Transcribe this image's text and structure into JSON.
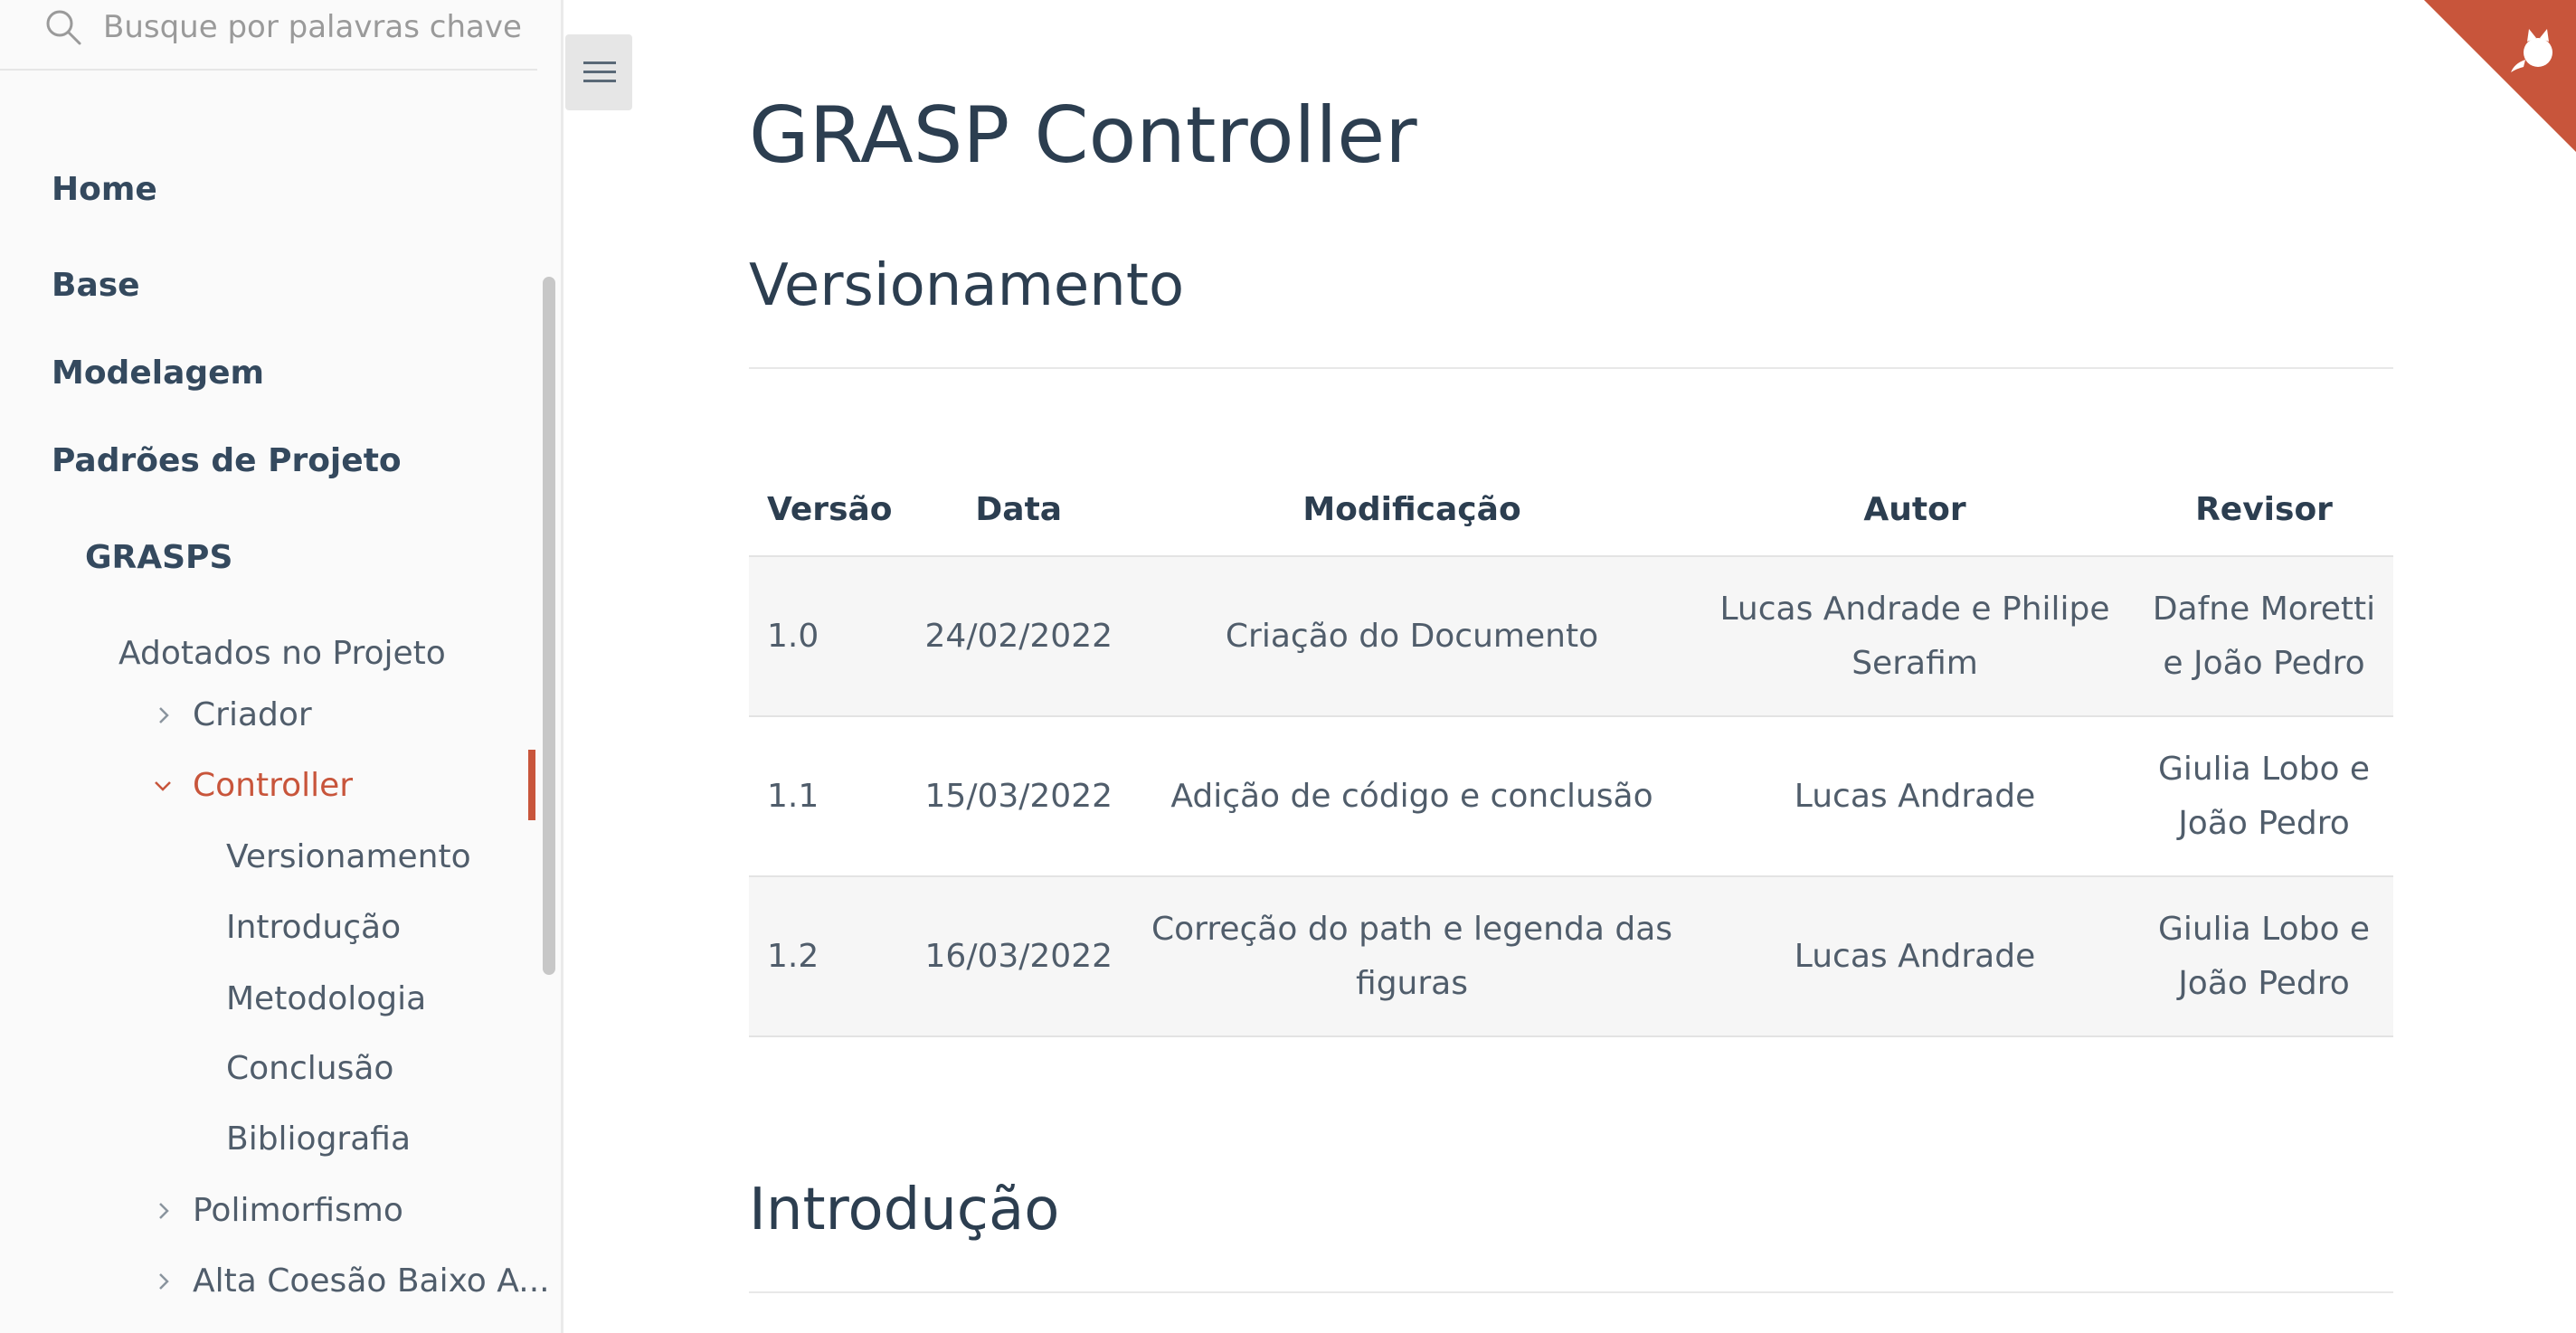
{
  "search": {
    "placeholder": "Busque por palavras chave",
    "icon": "search-icon"
  },
  "sidebar": {
    "items": [
      {
        "label": "Home"
      },
      {
        "label": "Base"
      },
      {
        "label": "Modelagem"
      },
      {
        "label": "Padrões de Projeto"
      },
      {
        "label": "GRASPS"
      },
      {
        "label": "Adotados no Projeto"
      },
      {
        "label": "Criador"
      },
      {
        "label": "Controller"
      },
      {
        "label": "Versionamento"
      },
      {
        "label": "Introdução"
      },
      {
        "label": "Metodologia"
      },
      {
        "label": "Conclusão"
      },
      {
        "label": "Bibliografia"
      },
      {
        "label": "Polimorfismo"
      },
      {
        "label": "Alta Coesão Baixo A..."
      }
    ],
    "active_color": "#c8553b"
  },
  "toolbar": {
    "menu_icon": "hamburger-menu-icon"
  },
  "corner": {
    "icon": "github-octocat-icon",
    "color": "#c8553b"
  },
  "main": {
    "title": "GRASP Controller",
    "section1": "Versionamento",
    "section2": "Introdução",
    "table": {
      "headers": [
        "Versão",
        "Data",
        "Modificação",
        "Autor",
        "Revisor"
      ],
      "rows": [
        [
          "1.0",
          "24/02/2022",
          "Criação do Documento",
          "Lucas Andrade e Philipe Serafim",
          "Dafne Moretti e João Pedro"
        ],
        [
          "1.1",
          "15/03/2022",
          "Adição de código e conclusão",
          "Lucas Andrade",
          "Giulia Lobo e João Pedro"
        ],
        [
          "1.2",
          "16/03/2022",
          "Correção do path e legenda das figuras",
          "Lucas Andrade",
          "Giulia Lobo e João Pedro"
        ]
      ]
    }
  }
}
